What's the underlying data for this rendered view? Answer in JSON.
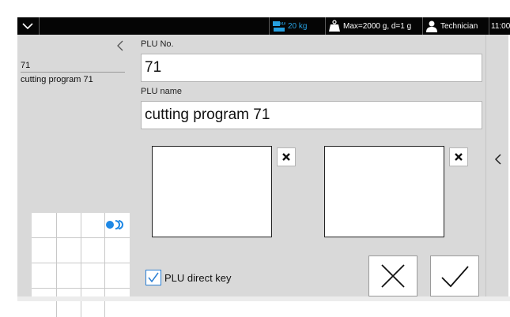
{
  "topbar": {
    "max_capacity": "20 kg",
    "range": "Max=2000 g, d=1 g",
    "user": "Technician",
    "time": "11:00"
  },
  "left_panel": {
    "plu_no": "71",
    "plu_name": "cutting program 71"
  },
  "form": {
    "plu_no_label": "PLU No.",
    "plu_no_value": "71",
    "plu_name_label": "PLU name",
    "plu_name_value": "cutting program 71",
    "direct_key_label": "PLU direct key",
    "direct_key_checked": true
  },
  "colors": {
    "accent_blue": "#2a7fd4",
    "topbar": "#050505",
    "panel": "#d9d9d9"
  },
  "icons": [
    "chevron-down-icon",
    "scale-icon",
    "weight-icon",
    "user-icon",
    "back-arrow-icon",
    "delete-x-icon",
    "cancel-icon",
    "confirm-icon",
    "side-arrow-icon"
  ]
}
